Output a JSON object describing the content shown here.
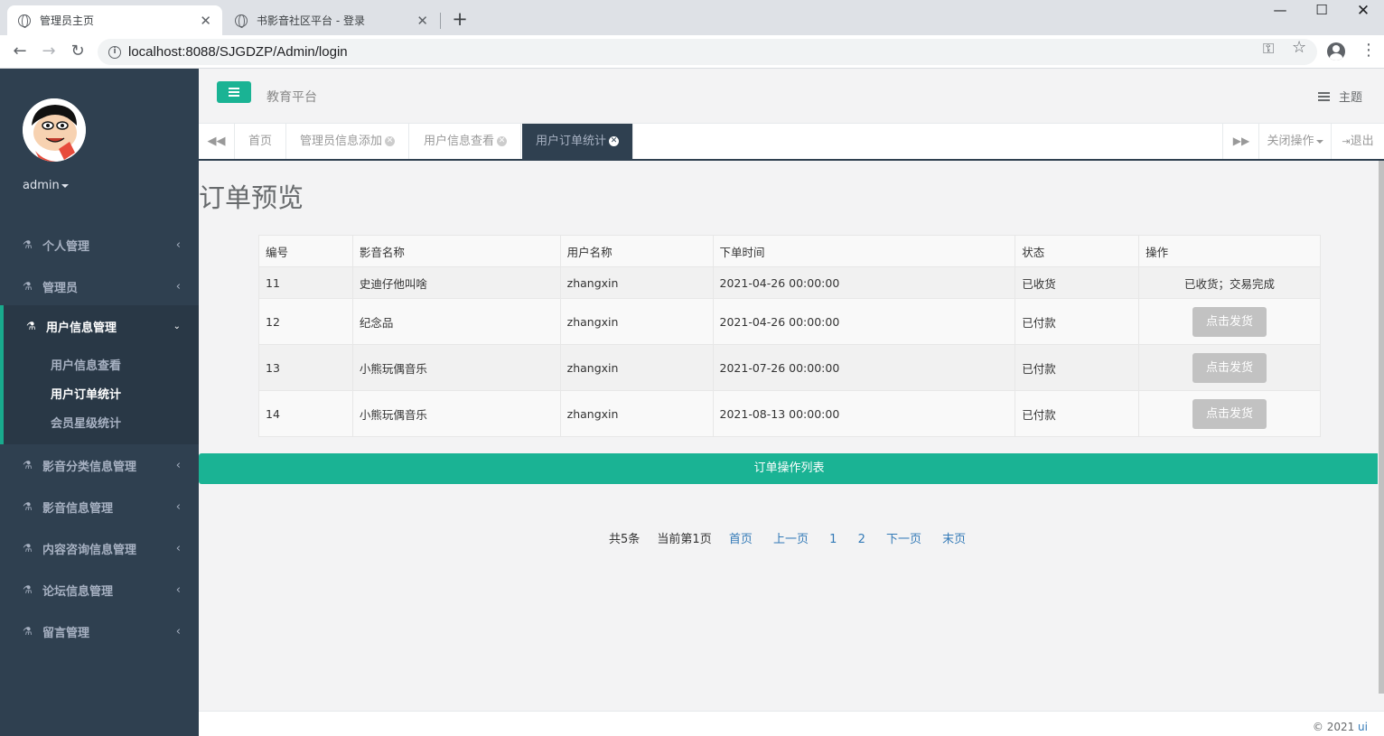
{
  "browser": {
    "tabs": [
      {
        "title": "管理员主页",
        "active": true
      },
      {
        "title": "书影音社区平台 - 登录",
        "active": false
      }
    ],
    "url": "localhost:8088/SJGDZP/Admin/login"
  },
  "sidebar": {
    "username": "admin",
    "menu": [
      {
        "label": "个人管理"
      },
      {
        "label": "管理员"
      },
      {
        "label": "用户信息管理",
        "expanded": true
      },
      {
        "label": "影音分类信息管理"
      },
      {
        "label": "影音信息管理"
      },
      {
        "label": "内容咨询信息管理"
      },
      {
        "label": "论坛信息管理"
      },
      {
        "label": "留言管理"
      }
    ],
    "submenu": [
      {
        "label": "用户信息查看",
        "active": false
      },
      {
        "label": "用户订单统计",
        "active": true
      },
      {
        "label": "会员星级统计",
        "active": false
      }
    ]
  },
  "navbar": {
    "platform": "教育平台",
    "theme_label": "主题"
  },
  "content_tabs": {
    "tabs": [
      {
        "label": "首页",
        "closable": false
      },
      {
        "label": "管理员信息添加",
        "closable": true
      },
      {
        "label": "用户信息查看",
        "closable": true
      },
      {
        "label": "用户订单统计",
        "closable": true,
        "active": true
      }
    ],
    "close_ops": "关闭操作",
    "logout": "退出"
  },
  "page": {
    "title": "订单预览",
    "table": {
      "headers": [
        "编号",
        "影音名称",
        "用户名称",
        "下单时间",
        "状态",
        "操作"
      ],
      "rows": [
        {
          "id": "11",
          "name": "史迪仔他叫啥",
          "user": "zhangxin",
          "time": "2021-04-26 00:00:00",
          "status": "已收货",
          "op_text": "已收货；交易完成",
          "op_button": ""
        },
        {
          "id": "12",
          "name": "纪念品",
          "user": "zhangxin",
          "time": "2021-04-26 00:00:00",
          "status": "已付款",
          "op_text": "",
          "op_button": "点击发货"
        },
        {
          "id": "13",
          "name": "小熊玩偶音乐",
          "user": "zhangxin",
          "time": "2021-07-26 00:00:00",
          "status": "已付款",
          "op_text": "",
          "op_button": "点击发货"
        },
        {
          "id": "14",
          "name": "小熊玩偶音乐",
          "user": "zhangxin",
          "time": "2021-08-13 00:00:00",
          "status": "已付款",
          "op_text": "",
          "op_button": "点击发货"
        }
      ]
    },
    "ops_bar": "订单操作列表",
    "pager": {
      "total": "共5条",
      "current": "当前第1页",
      "first": "首页",
      "prev": "上一页",
      "page1": "1",
      "page2": "2",
      "next": "下一页",
      "last": "末页"
    }
  },
  "footer": {
    "copyright": "© 2021 ",
    "brand": "ui"
  },
  "colors": {
    "sidebar_bg": "#2f4050",
    "accent": "#1ab394",
    "link": "#337ab7"
  }
}
